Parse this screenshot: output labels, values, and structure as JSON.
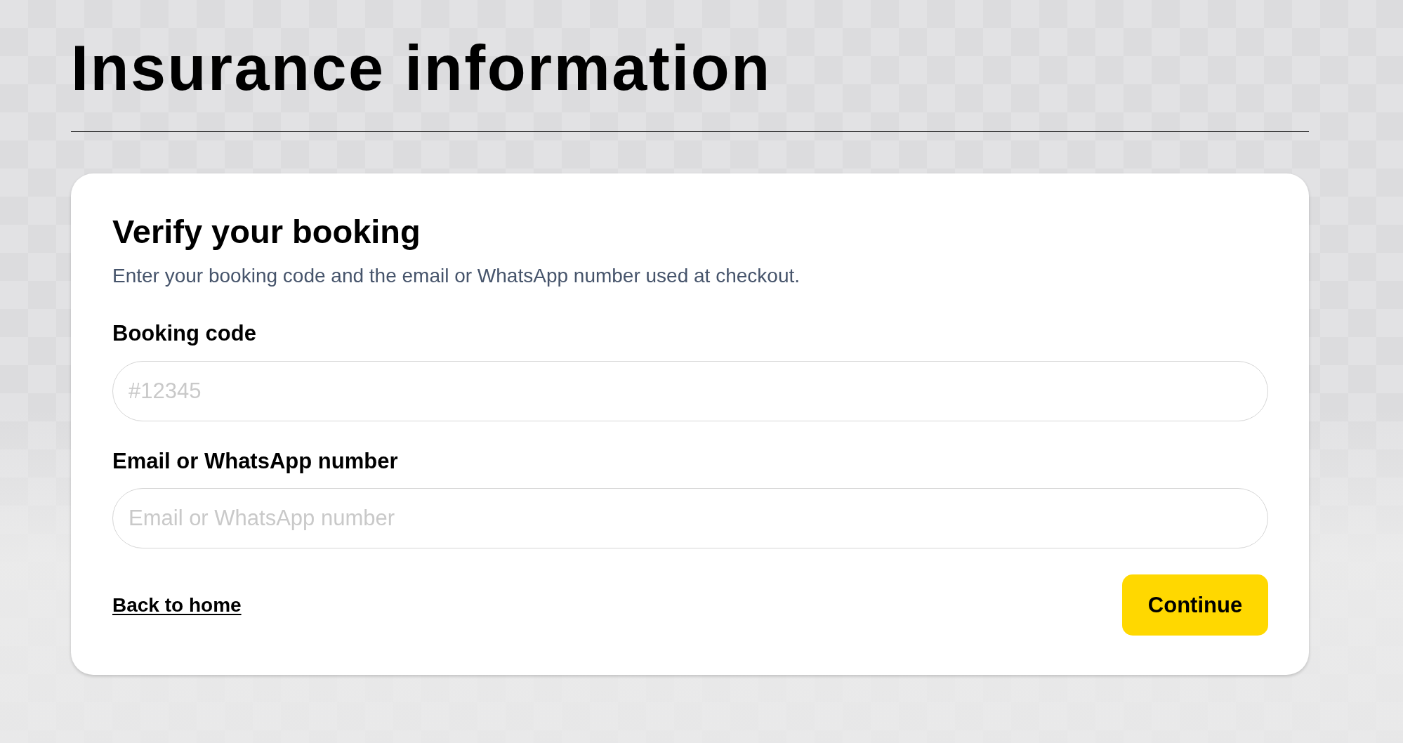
{
  "page_title": "Insurance information",
  "card": {
    "title": "Verify your booking",
    "description": "Enter your booking code and the email or WhatsApp number used at checkout.",
    "fields": [
      {
        "label": "Booking code",
        "placeholder": "#12345"
      },
      {
        "label": "Email or WhatsApp number",
        "placeholder": "Email or WhatsApp number"
      }
    ],
    "back_link": "Back to home",
    "submit_button": "Continue"
  }
}
